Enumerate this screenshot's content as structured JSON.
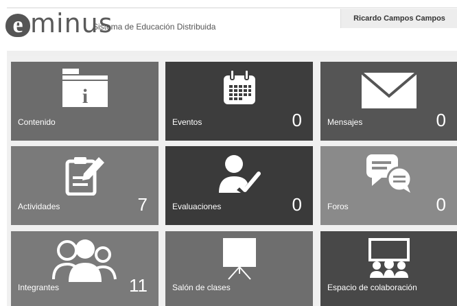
{
  "header": {
    "logo_first": "e",
    "logo_rest": "minus",
    "subtitle": "Sistema de Educación Distribuida",
    "user_name": "Ricardo Campos Campos"
  },
  "tiles": [
    {
      "label": "Contenido",
      "count": "",
      "icon": "folder-info-icon"
    },
    {
      "label": "Eventos",
      "count": "0",
      "icon": "calendar-icon"
    },
    {
      "label": "Mensajes",
      "count": "0",
      "icon": "envelope-icon"
    },
    {
      "label": "Actividades",
      "count": "7",
      "icon": "edit-document-icon"
    },
    {
      "label": "Evaluaciones",
      "count": "0",
      "icon": "user-check-icon"
    },
    {
      "label": "Foros",
      "count": "0",
      "icon": "chat-bubbles-icon"
    },
    {
      "label": "Integrantes",
      "count": "11",
      "icon": "group-icon"
    },
    {
      "label": "Salón de clases",
      "count": "",
      "icon": "presentation-board-icon"
    },
    {
      "label": "Espacio de colaboración",
      "count": "",
      "icon": "collaboration-icon"
    }
  ],
  "colors": {
    "tile_light": "#6c6c6c",
    "tile_dark": "#3c3c3c",
    "tile_mid": "#555555",
    "tile_soft": "#7a7a7a"
  }
}
